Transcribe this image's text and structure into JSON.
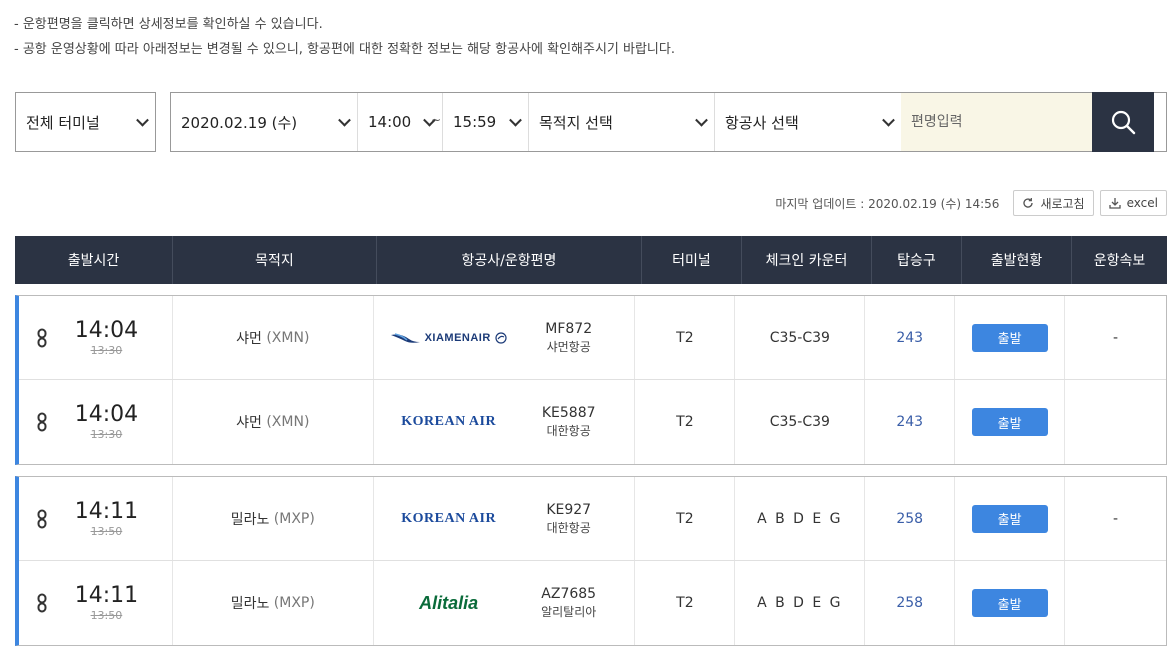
{
  "notice": {
    "line1": "-  운항편명을 클릭하면 상세정보를 확인하실 수 있습니다.",
    "line2": "-  공항 운영상황에 따라 아래정보는 변경될 수 있으니, 항공편에 대한 정확한 정보는 해당 항공사에 확인해주시기 바랍니다."
  },
  "filters": {
    "terminal": "전체 터미널",
    "date": "2020.02.19 (수)",
    "time_from": "14:00",
    "tilde": "~",
    "time_to": "15:59",
    "destination": "목적지 선택",
    "airline": "항공사 선택",
    "flight_placeholder": "편명입력"
  },
  "update": {
    "text": "마지막 업데이트 : 2020.02.19 (수) 14:56",
    "refresh_label": "새로고침",
    "excel_label": "excel"
  },
  "headers": [
    "출발시간",
    "목적지",
    "항공사/운항편명",
    "터미널",
    "체크인 카운터",
    "탑승구",
    "출발현황",
    "운항속보"
  ],
  "groups": [
    {
      "rows": [
        {
          "time": "14:04",
          "scheduled": "13:30",
          "dest": "샤먼",
          "dest_code": "(XMN)",
          "logo": "XIAMENAIR",
          "flight_no": "MF872",
          "airline": "샤먼항공",
          "terminal": "T2",
          "checkin": "C35-C39",
          "gate": "243",
          "status": "출발",
          "info": "-"
        },
        {
          "time": "14:04",
          "scheduled": "13:30",
          "dest": "샤먼",
          "dest_code": "(XMN)",
          "logo": "KOREAN AIR",
          "flight_no": "KE5887",
          "airline": "대한항공",
          "terminal": "T2",
          "checkin": "C35-C39",
          "gate": "243",
          "status": "출발",
          "info": ""
        }
      ]
    },
    {
      "rows": [
        {
          "time": "14:11",
          "scheduled": "13:50",
          "dest": "밀라노",
          "dest_code": "(MXP)",
          "logo": "KOREAN AIR",
          "flight_no": "KE927",
          "airline": "대한항공",
          "terminal": "T2",
          "checkin": "A B D E G",
          "gate": "258",
          "status": "출발",
          "info": "-"
        },
        {
          "time": "14:11",
          "scheduled": "13:50",
          "dest": "밀라노",
          "dest_code": "(MXP)",
          "logo": "Alitalia",
          "flight_no": "AZ7685",
          "airline": "알리탈리아",
          "terminal": "T2",
          "checkin": "A B D E G",
          "gate": "258",
          "status": "출발",
          "info": ""
        }
      ]
    }
  ],
  "colors": {
    "accent": "#3d86e0",
    "header_bg": "#2b3343",
    "search_bg": "#2b3343"
  }
}
